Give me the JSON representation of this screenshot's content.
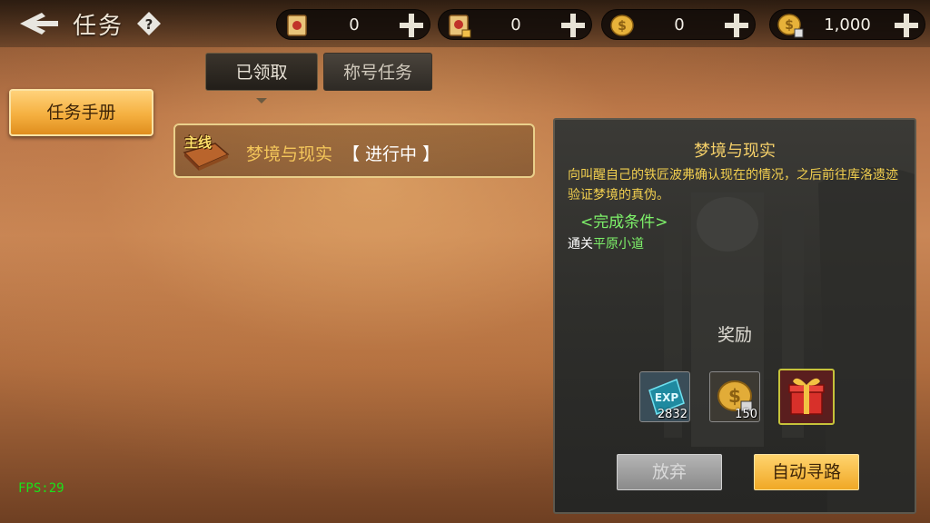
{
  "header": {
    "title": "任务"
  },
  "resources": [
    {
      "icon": "scroll-icon",
      "value": "0"
    },
    {
      "icon": "locked-scroll-icon",
      "value": "0"
    },
    {
      "icon": "gold-coin-icon",
      "value": "0"
    },
    {
      "icon": "locked-gold-coin-icon",
      "value": "1,000"
    }
  ],
  "tabs": [
    {
      "label": "已领取",
      "active": true
    },
    {
      "label": "称号任务",
      "active": false
    }
  ],
  "sidebar": {
    "manual_label": "任务手册"
  },
  "quest_list": [
    {
      "badge": "主线",
      "name": "梦境与现实",
      "status": "【 进行中 】"
    }
  ],
  "detail": {
    "title": "梦境与现实",
    "description": "向叫醒自己的铁匠波弗确认现在的情况，之后前往库洛遗迹验证梦境的真伪。",
    "condition_header": "<完成条件>",
    "condition_prefix": "通关",
    "condition_place": "平原小道",
    "reward_title": "奖励",
    "rewards": [
      {
        "icon": "exp-icon",
        "qty": "2832"
      },
      {
        "icon": "locked-gold-coin-icon",
        "qty": "150"
      },
      {
        "icon": "gift-box-icon",
        "qty": ""
      }
    ],
    "giveup_label": "放弃",
    "auto_path_label": "自动寻路"
  },
  "fps": "FPS:29",
  "colors": {
    "quest_name": "#f3c55a",
    "condition_green": "#7ef26a",
    "button_gold": "#f0a826"
  }
}
